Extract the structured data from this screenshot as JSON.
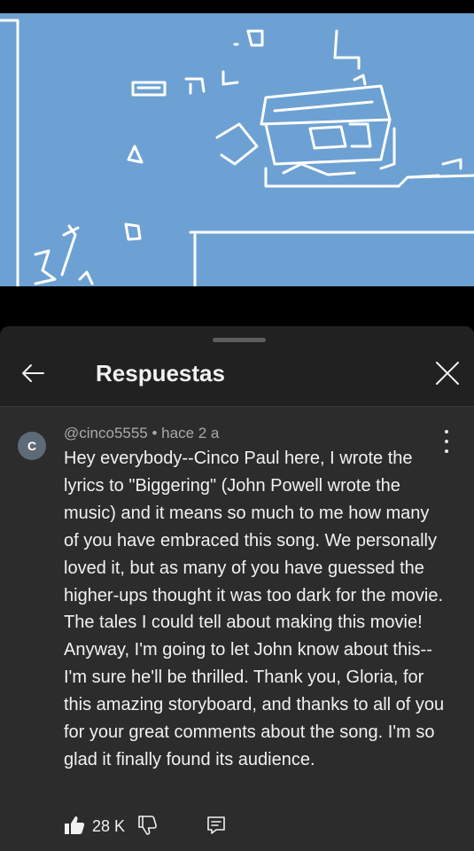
{
  "video": {
    "background_color": "#6da1d3",
    "content": "storyboard sketch"
  },
  "sheet": {
    "title": "Respuestas",
    "back_icon": "back-arrow-icon",
    "close_icon": "close-icon"
  },
  "comment": {
    "avatar_letter": "C",
    "author": "@cinco5555",
    "separator": "•",
    "time": "hace 2 a",
    "meta": "@cinco5555 • hace 2 a",
    "text": "Hey everybody--Cinco Paul here, I wrote the lyrics to \"Biggering\" (John Powell wrote the music) and it means so much to me how many of you have embraced this song. We personally loved it, but as many of you have guessed the higher-ups thought it was too dark for the movie. The tales I could tell about making this movie! Anyway, I'm going to let John know about this--I'm sure he'll be thrilled. Thank you, Gloria, for this amazing storyboard, and thanks to all of you for your great comments about the song. I'm so glad it finally found its audience.",
    "like_count": "28 K",
    "more_icon": "more-vert-icon",
    "like_icon": "thumb-up-filled-icon",
    "dislike_icon": "thumb-down-icon",
    "reply_icon": "reply-icon"
  }
}
